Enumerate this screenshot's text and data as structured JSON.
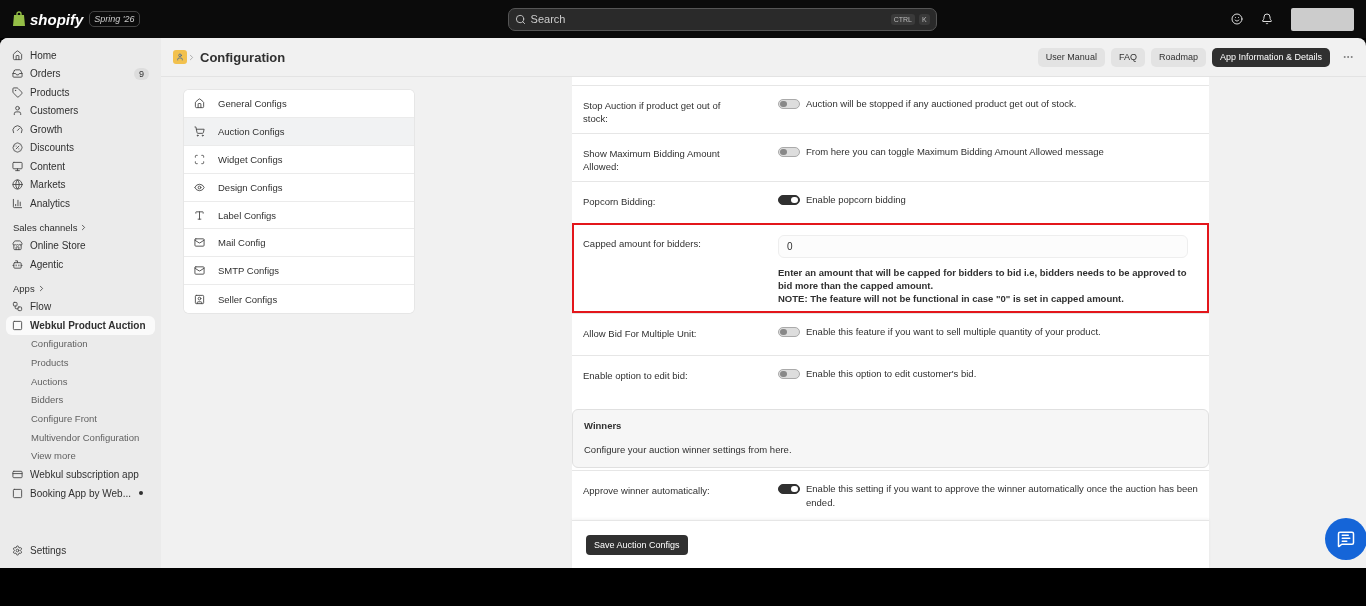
{
  "topbar": {
    "logo": "shopify",
    "edition": "Spring '26",
    "search": {
      "placeholder": "Search",
      "keys": [
        "CTRL",
        "K"
      ]
    }
  },
  "sidebar": {
    "items": [
      {
        "label": "Home",
        "selected": false
      },
      {
        "label": "Orders",
        "badge": "9",
        "selected": false
      },
      {
        "label": "Products",
        "selected": false
      },
      {
        "label": "Customers",
        "selected": false
      },
      {
        "label": "Growth",
        "selected": false
      },
      {
        "label": "Discounts",
        "selected": false
      },
      {
        "label": "Content",
        "selected": false
      },
      {
        "label": "Markets",
        "selected": false
      },
      {
        "label": "Analytics",
        "selected": false
      }
    ],
    "sales_channels": {
      "title": "Sales channels",
      "items": [
        {
          "label": "Online Store",
          "selected": false
        },
        {
          "label": "Agentic",
          "selected": false
        }
      ]
    },
    "apps": {
      "title": "Apps",
      "items": [
        {
          "label": "Flow",
          "selected": false,
          "pinned": false
        },
        {
          "label": "Webkul Product Auction",
          "selected": true,
          "pinned": false,
          "children": [
            {
              "label": "Configuration",
              "selected": false
            },
            {
              "label": "Products",
              "selected": false
            },
            {
              "label": "Auctions",
              "selected": false
            },
            {
              "label": "Bidders",
              "selected": false
            },
            {
              "label": "Configure Front",
              "selected": false
            },
            {
              "label": "Multivendor Configuration",
              "selected": false
            },
            {
              "label": "View more",
              "selected": false
            }
          ]
        },
        {
          "label": "Webkul subscription app",
          "selected": false,
          "pinned": false
        },
        {
          "label": "Booking App by Web...",
          "selected": false,
          "pinned": true
        }
      ]
    },
    "settings": "Settings"
  },
  "header": {
    "title": "Configuration",
    "actions": [
      {
        "label": "User Manual",
        "primary": false
      },
      {
        "label": "FAQ",
        "primary": false
      },
      {
        "label": "Roadmap",
        "primary": false
      },
      {
        "label": "App Information & Details",
        "primary": true
      }
    ]
  },
  "config_nav": [
    {
      "label": "General Configs",
      "selected": false
    },
    {
      "label": "Auction Configs",
      "selected": true
    },
    {
      "label": "Widget Configs",
      "selected": false
    },
    {
      "label": "Design Configs",
      "selected": false
    },
    {
      "label": "Label Configs",
      "selected": false
    },
    {
      "label": "Mail Config",
      "selected": false
    },
    {
      "label": "SMTP Configs",
      "selected": false
    },
    {
      "label": "Seller Configs",
      "selected": false
    }
  ],
  "settings_rows": [
    {
      "kind": "toggle",
      "label": "Stop Auction if product get out of stock:",
      "on": false,
      "description": "Auction will be stopped if any auctioned product get out of stock."
    },
    {
      "kind": "toggle",
      "label": "Show Maximum Bidding Amount Allowed:",
      "on": false,
      "description": "From here you can toggle Maximum Bidding Amount Allowed message"
    },
    {
      "kind": "toggle",
      "label": "Popcorn Bidding:",
      "on": true,
      "description": "Enable popcorn bidding"
    },
    {
      "kind": "input",
      "label": "Capped amount for bidders:",
      "value": "0",
      "highlighted": true,
      "help": [
        "Enter an amount that will be capped for bidders to bid i.e, bidders needs to be approved to bid more than the capped amount.",
        "NOTE: The feature will not be functional in case \"0\" is set in capped amount."
      ]
    },
    {
      "kind": "toggle",
      "label": "Allow Bid For Multiple Unit:",
      "on": false,
      "description": "Enable this feature if you want to sell multiple quantity of your product."
    },
    {
      "kind": "toggle",
      "label": "Enable option to edit bid:",
      "on": false,
      "description": "Enable this option to edit customer's bid."
    },
    {
      "kind": "section",
      "title": "Winners",
      "description": "Configure your auction winner settings from here."
    },
    {
      "kind": "toggle",
      "label": "Approve winner automatically:",
      "on": true,
      "description": "Enable this setting if you want to approve the winner automatically once the auction has been ended."
    }
  ],
  "save_button": "Save Auction Configs"
}
